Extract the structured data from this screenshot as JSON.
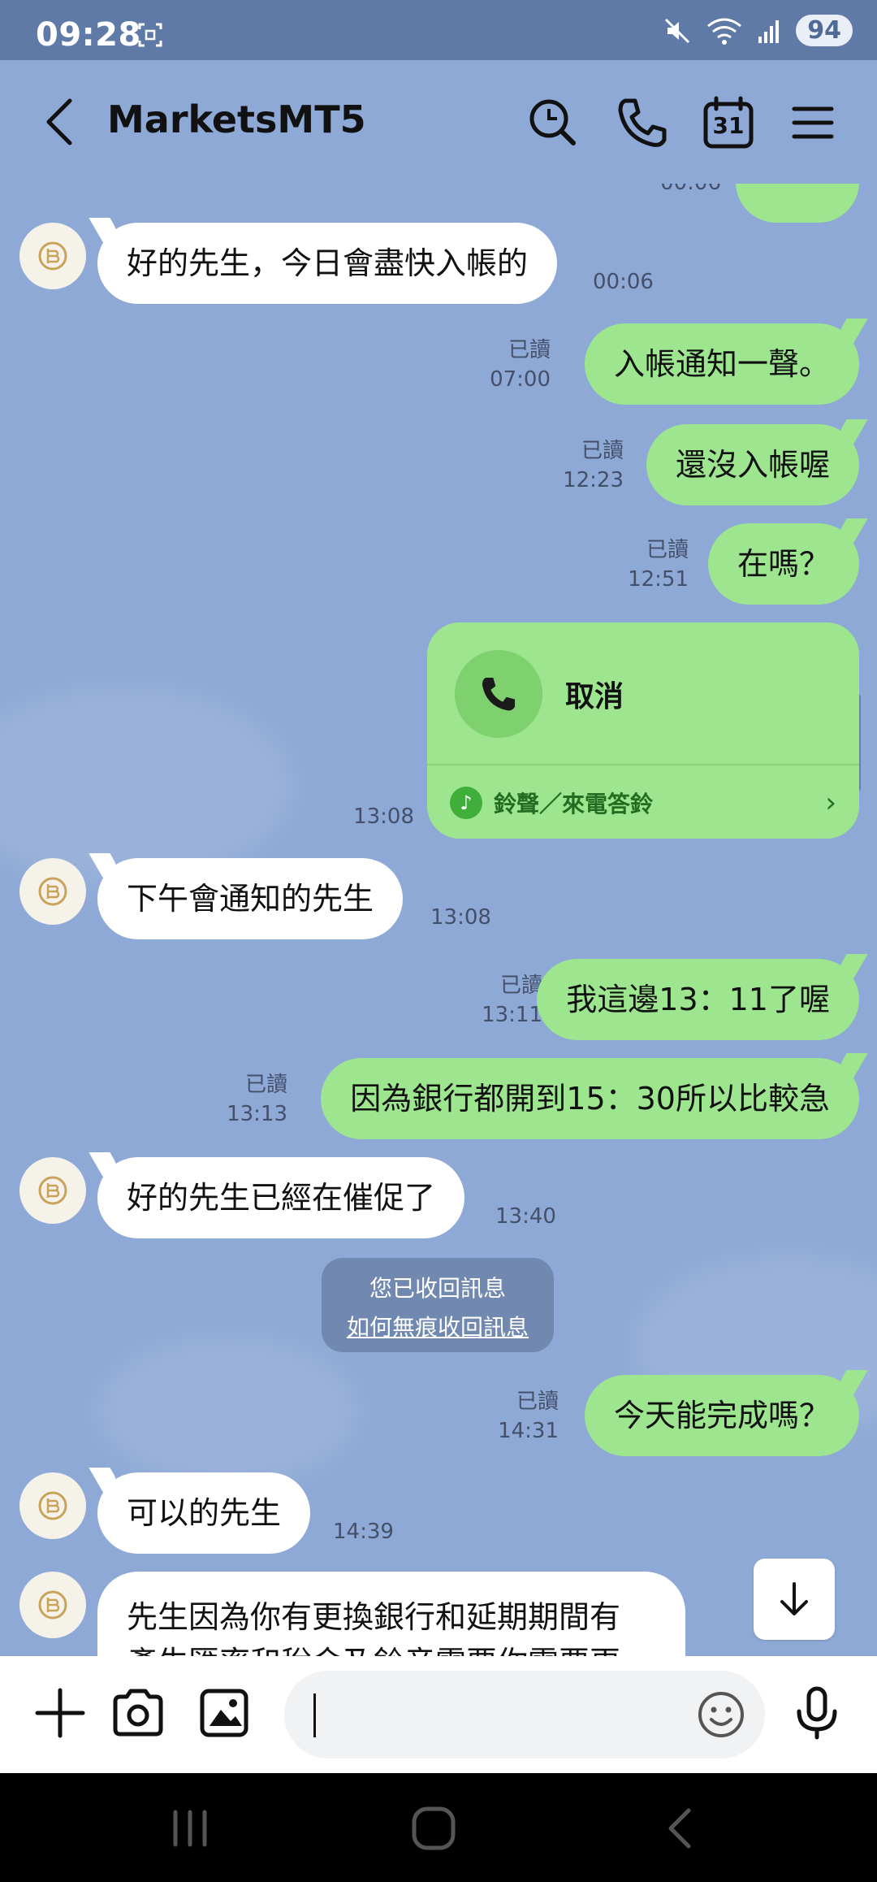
{
  "status": {
    "time": "09:28",
    "battery": "94"
  },
  "header": {
    "title": "MarketsMT5",
    "calendar_day": "31"
  },
  "messages": {
    "m0_time": "00:06",
    "m1": {
      "text": "好的先生，今日會盡快入帳的",
      "time": "00:06"
    },
    "m2": {
      "text": "入帳通知一聲。",
      "read": "已讀",
      "time": "07:00"
    },
    "m3": {
      "text": "還沒入帳喔",
      "read": "已讀",
      "time": "12:23"
    },
    "m4": {
      "text": "在嗎？",
      "read": "已讀",
      "time": "12:51"
    },
    "call": {
      "label": "取消",
      "ringtone": "鈴聲／來電答鈴",
      "time": "13:08"
    },
    "m5": {
      "text": "下午會通知的先生",
      "time": "13:08"
    },
    "m6": {
      "text": "我這邊13：11了喔",
      "read": "已讀",
      "time": "13:11"
    },
    "m7": {
      "text": "因為銀行都開到15：30所以比較急",
      "read": "已讀",
      "time": "13:13"
    },
    "m8": {
      "text": "好的先生已經在催促了",
      "time": "13:40"
    },
    "notice": {
      "line1": "您已收回訊息",
      "line2": "如何無痕收回訊息"
    },
    "m9": {
      "text": "今天能完成嗎？",
      "read": "已讀",
      "time": "14:31"
    },
    "m10": {
      "text": "可以的先生",
      "time": "14:39"
    },
    "m11": {
      "line1": "先生因為你有更換銀行和延期期間有",
      "line2": "產生匯率和稅金及鈴音需要你需要更"
    }
  },
  "colors": {
    "chat_bg": "#8ea9d6",
    "outgoing_bubble": "#9de58e",
    "incoming_bubble": "#ffffff",
    "status_bar": "#5f7aa6"
  },
  "icons": {
    "header": [
      "back-icon",
      "search-icon",
      "phone-icon",
      "calendar-icon",
      "menu-icon"
    ],
    "input": [
      "plus-icon",
      "camera-icon",
      "image-icon",
      "emoji-icon",
      "mic-icon"
    ]
  }
}
